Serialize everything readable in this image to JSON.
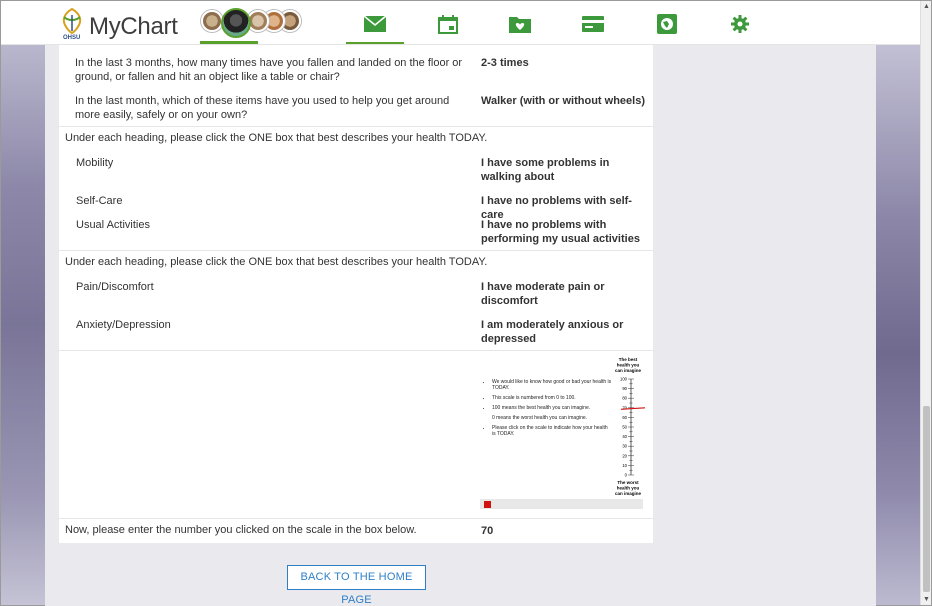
{
  "header": {
    "app_name": "MyChart",
    "org": "OHSU",
    "nav": [
      {
        "id": "messages",
        "icon": "envelope-icon"
      },
      {
        "id": "visits",
        "icon": "calendar-icon"
      },
      {
        "id": "health",
        "icon": "folder-heart-icon"
      },
      {
        "id": "billing",
        "icon": "credit-card-icon"
      },
      {
        "id": "resources",
        "icon": "globe-book-icon"
      },
      {
        "id": "settings",
        "icon": "gear-icon"
      }
    ],
    "accent": "#5aa02c"
  },
  "answers": {
    "falls_q": "In the last 3 months, how many times have you fallen and landed on the floor or ground, or fallen and hit an object like a table or chair?",
    "falls_a": "2-3 times",
    "mobility_aid_q": "In the last month, which of these items have you used to help you get around more easily, safely or on your own?",
    "mobility_aid_a": "Walker (with or without wheels)",
    "heading1": "Under each heading, please click the ONE box that best describes your health TODAY.",
    "mobility_q": "Mobility",
    "mobility_a": "I have some problems in walking about",
    "selfcare_q": "Self-Care",
    "selfcare_a": "I have no problems with self-care",
    "usual_q": "Usual Activities",
    "usual_a": "I have no problems with performing my usual activities",
    "heading2": "Under each heading, please click the ONE box that best describes your health TODAY.",
    "pain_q": "Pain/Discomfort",
    "pain_a": "I have moderate pain or discomfort",
    "anxiety_q": "Anxiety/Depression",
    "anxiety_a": "I am moderately anxious or depressed",
    "scale_number_q": "Now, please enter the number you clicked on the scale in the box below.",
    "scale_number_a": "70"
  },
  "scale": {
    "top_label": "The best health you can imagine",
    "bottom_label": "The worst health you can imagine",
    "instructions": [
      "We would like to know how good or bad your health is TODAY.",
      "This scale is numbered from 0 to 100.",
      "100 means the best health you can imagine.",
      "0 means the worst health you can imagine.",
      "Please click on the scale to indicate how your health is TODAY."
    ],
    "ticks": [
      "100",
      "90",
      "80",
      "70",
      "60",
      "50",
      "40",
      "30",
      "20",
      "10",
      "0"
    ],
    "selected_value": 70,
    "marker_color": "#d21111"
  },
  "footer": {
    "home_button": "BACK TO THE HOME PAGE"
  }
}
